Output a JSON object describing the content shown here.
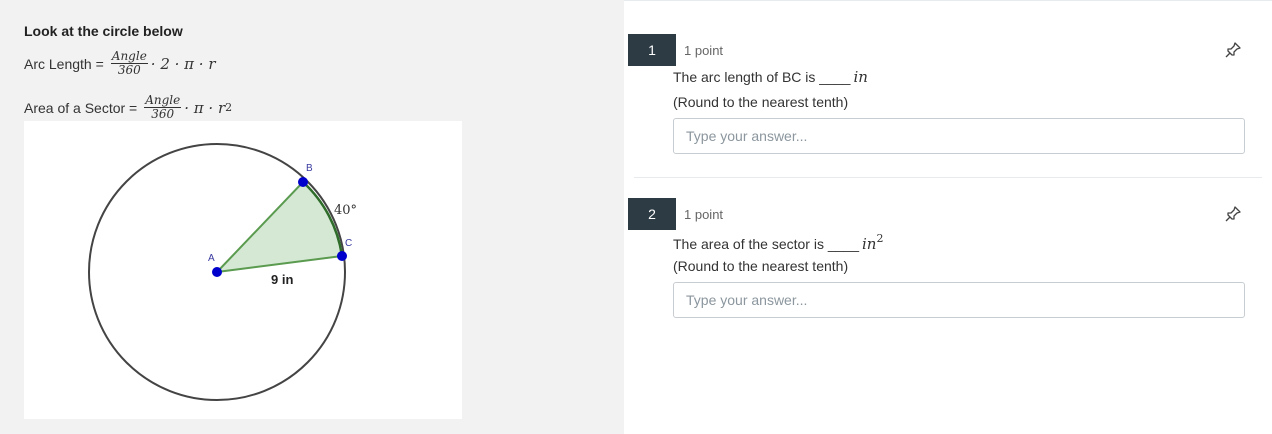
{
  "left_panel": {
    "heading": "Look at the circle below",
    "arc_formula": {
      "label": "Arc Length =",
      "frac_num": "Angle",
      "frac_den": "360",
      "rest": "· 2 · π · r"
    },
    "sector_formula": {
      "label": "Area of a Sector =",
      "frac_num": "Angle",
      "frac_den": "360",
      "rest": "· π · r",
      "exp": "2"
    },
    "diagram": {
      "point_a": "A",
      "point_b": "B",
      "point_c": "C",
      "angle_label": "40°",
      "radius_label": "9 in",
      "sector_color": "#d5e8d4",
      "sector_stroke": "#5a9b4f",
      "point_color": "#0000cc"
    }
  },
  "questions": [
    {
      "number": "1",
      "points": "1 point",
      "text_before": "The arc length of BC is ____",
      "unit": "in",
      "unit_exp": "",
      "note": "(Round to the nearest tenth)",
      "placeholder": "Type your answer..."
    },
    {
      "number": "2",
      "points": "1 point",
      "text_before": "The area of the sector is ____",
      "unit": "in",
      "unit_exp": "2",
      "note": "(Round to the nearest tenth)",
      "placeholder": "Type your answer..."
    }
  ]
}
